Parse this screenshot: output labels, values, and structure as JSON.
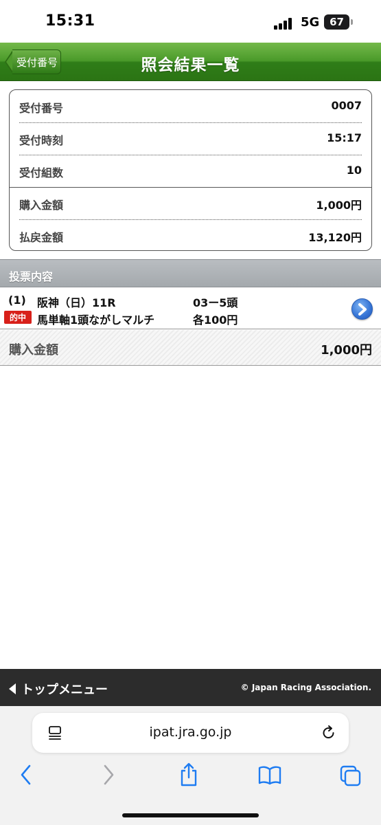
{
  "status_bar": {
    "time": "15:31",
    "network": "5G",
    "battery": "67"
  },
  "header": {
    "back_label": "受付番号",
    "title": "照会結果一覧"
  },
  "receipt": {
    "rows": [
      {
        "label": "受付番号",
        "value": "0007"
      },
      {
        "label": "受付時刻",
        "value": "15:17"
      },
      {
        "label": "受付組数",
        "value": "10"
      },
      {
        "label": "購入金額",
        "value": "1,000円"
      },
      {
        "label": "払戻金額",
        "value": "13,120円"
      }
    ]
  },
  "bet_section": {
    "title": "投票内容",
    "item": {
      "number": "(1)",
      "race": "阪神（日）11R",
      "selection": "03ー5頭",
      "badge": "的中",
      "bet_type": "馬単軸1頭ながしマルチ",
      "unit": "各100円"
    },
    "total_label": "購入金額",
    "total_value": "1,000円"
  },
  "footer": {
    "menu_label": "トップメニュー",
    "copyright": "© Japan Racing Association."
  },
  "browser": {
    "url": "ipat.jra.go.jp"
  },
  "colors": {
    "header_green": "#3f8f22",
    "hit_badge": "#d8201a",
    "footer": "#2c2c2c",
    "safari_blue": "#1e7cf2"
  }
}
